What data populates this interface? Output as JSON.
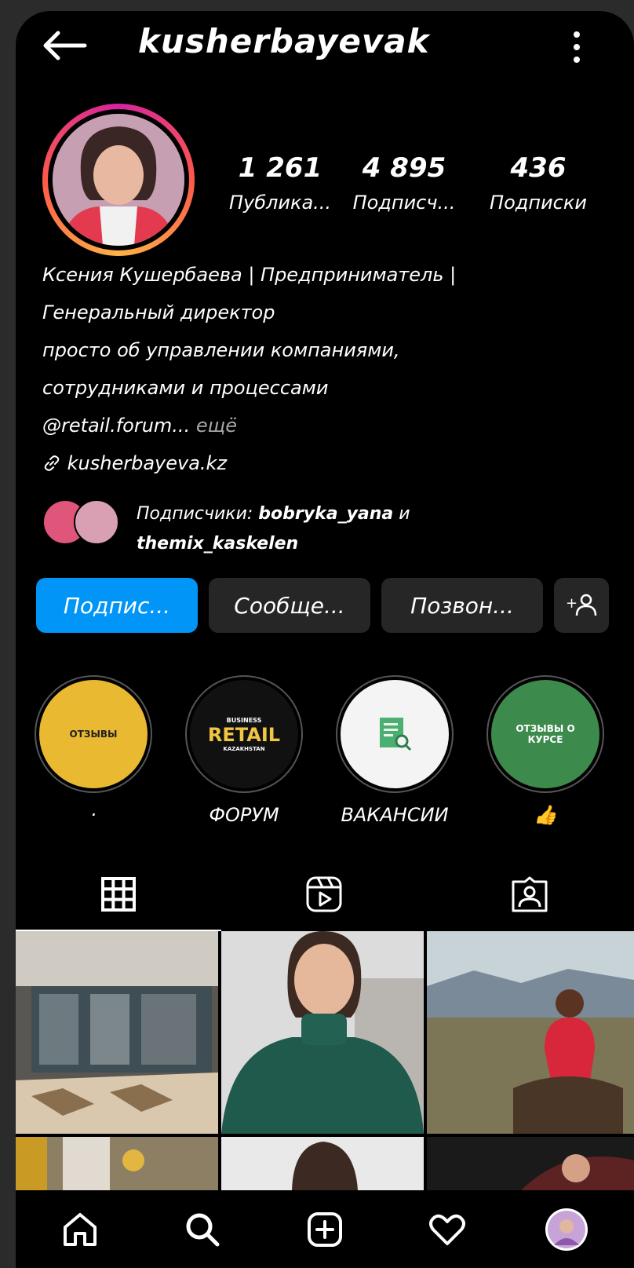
{
  "header": {
    "username": "kusherbayevak"
  },
  "stats": [
    {
      "value": "1 261",
      "label": "Публика..."
    },
    {
      "value": "4 895",
      "label": "Подписч..."
    },
    {
      "value": "436",
      "label": "Подписки"
    }
  ],
  "bio": {
    "line1": "Ксения Кушербаева | Предприниматель |",
    "line2": "Генеральный директор",
    "line3": "просто об управлении компаниями,",
    "line4": "сотрудниками и процессами",
    "mention": "@retail.forum...",
    "more": "ещё",
    "link": "kusherbayeva.kz"
  },
  "followers": {
    "prefix": "Подписчики:",
    "user1": "bobryka_yana",
    "conj": "и",
    "user2": "themix_kaskelen"
  },
  "actions": {
    "follow": "Подпис...",
    "message": "Сообще...",
    "call": "Позвон...",
    "add_person": "+"
  },
  "highlights": [
    {
      "inner": "ОТЗЫВЫ",
      "label": "·",
      "color": "#e9b932"
    },
    {
      "inner_top": "BUSINESS",
      "inner": "RETAIL",
      "inner_sub": "KAZAKHSTAN",
      "label": "ФОРУМ",
      "color": "#111111"
    },
    {
      "inner": "",
      "label": "ВАКАНСИИ",
      "color": "#f4f4f4"
    },
    {
      "inner": "ОТЗЫВЫ О КУРСЕ",
      "label": "👍",
      "color": "#3d8a4d"
    }
  ],
  "tabs": [
    "grid-icon",
    "reels-icon",
    "tagged-icon"
  ],
  "nav": [
    "home-icon",
    "search-icon",
    "new-post-icon",
    "activity-icon",
    "profile-icon"
  ],
  "colors": {
    "primary": "#0095f6",
    "button": "#262626",
    "background": "#000000"
  }
}
